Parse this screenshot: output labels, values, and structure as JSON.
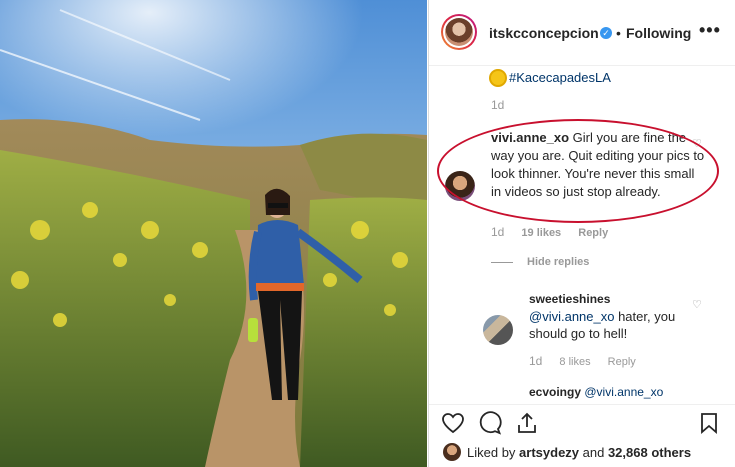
{
  "post": {
    "username": "itskcconcepcion",
    "separator": "•",
    "follow_label": "Following",
    "more_label": "•••",
    "verified_glyph": "✓"
  },
  "comments": {
    "hashtag": "#KacecapadesLA",
    "hashtag_time": "1d",
    "first": {
      "username": "vivi.anne_xo",
      "text": "Girl you are fine the way you are. Quit editing your pics to look thinner. You're never this small in videos so just stop already.",
      "time": "1d",
      "likes": "19 likes",
      "reply_label": "Reply"
    },
    "hide_replies_label": "Hide replies",
    "reply": {
      "username": "sweetieshines",
      "mention": "@vivi.anne_xo",
      "text": " hater, you should go to hell!",
      "time": "1d",
      "likes": "8 likes",
      "reply_label": "Reply"
    },
    "partial": {
      "username": "ecvoingy",
      "mention": "@vivi.anne_xo"
    }
  },
  "actions": {
    "liked_by_prefix": "Liked by ",
    "liked_by_user": "artsydezy",
    "liked_by_middle": " and ",
    "liked_by_count": "32,868 others"
  },
  "icons": [
    "verified-badge-icon",
    "heart-icon",
    "comment-icon",
    "share-icon",
    "bookmark-icon",
    "sun-emoji-icon"
  ],
  "colors": {
    "accent_link": "#003569",
    "verified": "#3897f0",
    "annotation_ellipse": "#c8102e",
    "muted": "#999999"
  }
}
